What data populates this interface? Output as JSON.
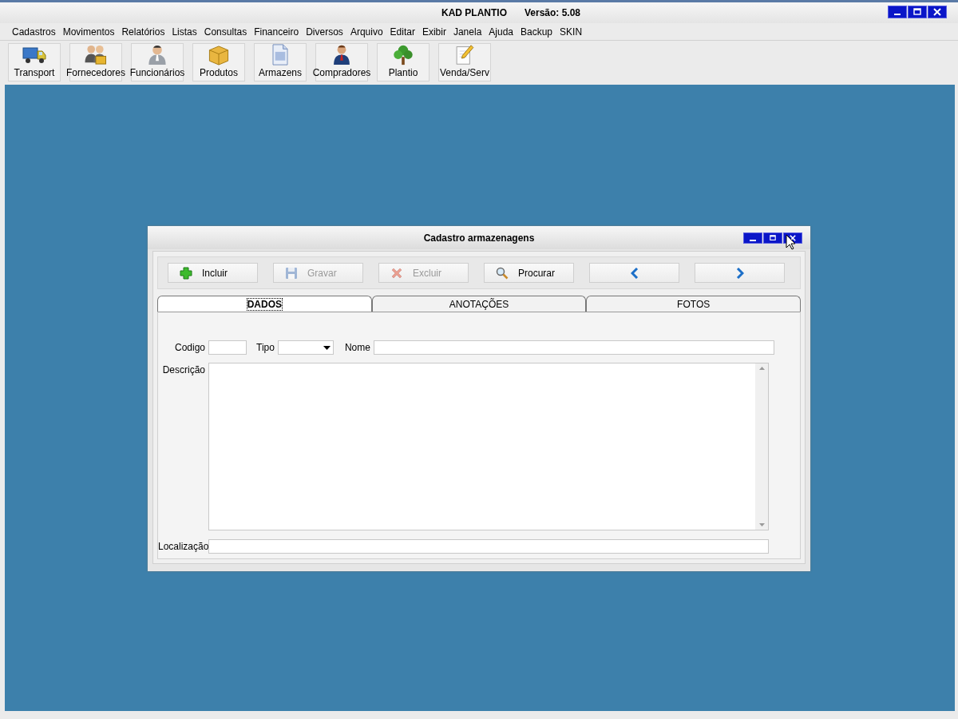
{
  "window": {
    "title": "KAD PLANTIO",
    "version": "Versão: 5.08"
  },
  "menu": [
    "Cadastros",
    "Movimentos",
    "Relatórios",
    "Listas",
    "Consultas",
    "Financeiro",
    "Diversos",
    "Arquivo",
    "Editar",
    "Exibir",
    "Janela",
    "Ajuda",
    "Backup",
    "SKIN"
  ],
  "toolbar": [
    {
      "label": "Transport",
      "kind": "truck"
    },
    {
      "label": "Fornecedores",
      "kind": "people"
    },
    {
      "label": "Funcionários",
      "kind": "person"
    },
    {
      "label": "Produtos",
      "kind": "box"
    },
    {
      "label": "Armazens",
      "kind": "document"
    },
    {
      "label": "Compradores",
      "kind": "manager"
    },
    {
      "label": "Plantio",
      "kind": "tree"
    },
    {
      "label": "Venda/Serv",
      "kind": "pencil"
    }
  ],
  "dialog": {
    "title": "Cadastro armazenagens",
    "buttons": [
      {
        "label": "Incluir",
        "kind": "plus",
        "disabled": false
      },
      {
        "label": "Gravar",
        "kind": "save",
        "disabled": true
      },
      {
        "label": "Excluir",
        "kind": "delete",
        "disabled": true
      },
      {
        "label": "Procurar",
        "kind": "search",
        "disabled": false
      },
      {
        "kind": "prev",
        "disabled": false
      },
      {
        "kind": "next",
        "disabled": false
      }
    ],
    "tabs": [
      {
        "label": "DADOS",
        "selected": true
      },
      {
        "label": "ANOTAÇÕES",
        "selected": false
      },
      {
        "label": "FOTOS",
        "selected": false
      }
    ],
    "fields": {
      "codigo": {
        "label": "Codigo"
      },
      "tipo": {
        "label": "Tipo"
      },
      "nome": {
        "label": "Nome"
      },
      "descricao": {
        "label": "Descrição"
      },
      "localizacao": {
        "label": "Localização"
      }
    }
  }
}
